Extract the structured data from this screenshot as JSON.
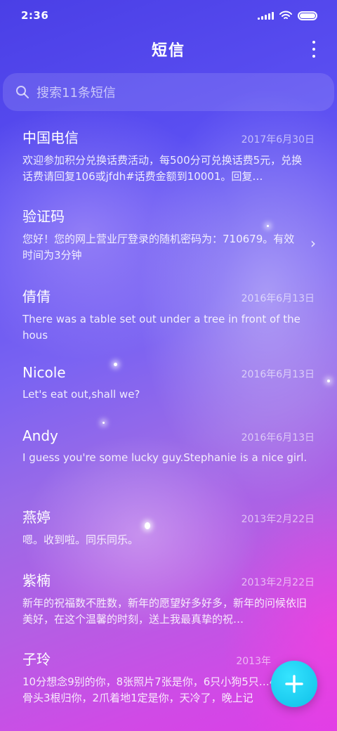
{
  "status_bar": {
    "time": "2:36"
  },
  "header": {
    "title": "短信"
  },
  "search": {
    "placeholder": "搜索11条短信"
  },
  "messages": [
    {
      "sender": "中国电信",
      "date": "2017年6月30日",
      "preview": "欢迎参加积分兑换话费活动，每500分可兑换话费5元，兑换话费请回复106或jfdh#话费金额到10001。回复…"
    },
    {
      "sender": "验证码",
      "date": "",
      "preview": "您好！您的网上营业厅登录的随机密码为：710679。有效时间为3分钟"
    },
    {
      "sender": "倩倩",
      "date": "2016年6月13日",
      "preview": "There was a table set out under a tree in front of the hous"
    },
    {
      "sender": "Nicole",
      "date": "2016年6月13日",
      "preview": "Let's eat out,shall we?"
    },
    {
      "sender": "Andy",
      "date": "2016年6月13日",
      "preview": "I guess you're some lucky guy.Stephanie is a nice girl."
    },
    {
      "sender": "燕婷",
      "date": "2013年2月22日",
      "preview": "嗯。收到啦。同乐同乐。"
    },
    {
      "sender": "紫楠",
      "date": "2013年2月22日",
      "preview": "新年的祝福数不胜数，新年的愿望好多好多，新年的问候依旧美好，在这个温馨的时刻，送上我最真挚的祝…"
    },
    {
      "sender": "子玲",
      "date": "2013年",
      "preview": "10分想念9别的你，8张照片7张是你，6只小狗5只…4根骨头3根归你，2爪着地1定是你，天冷了，晚上记"
    }
  ],
  "icons": {
    "search": "search-icon",
    "more": "more-vertical-icon",
    "chevron": "chevron-right-icon",
    "compose": "plus-icon",
    "signal": "signal-icon",
    "wifi": "wifi-icon",
    "battery": "battery-icon"
  },
  "colors": {
    "fab": "#1ccdf0"
  }
}
